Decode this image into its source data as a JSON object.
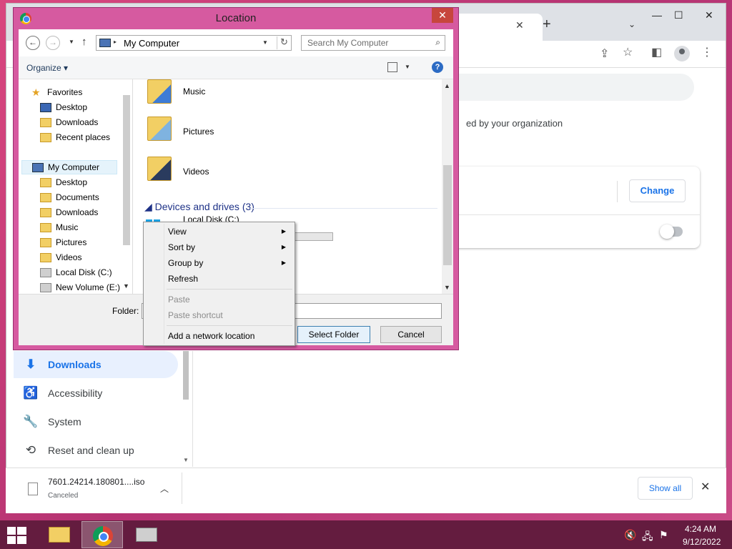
{
  "chrome": {
    "managed_text": "ed by your organization",
    "change_label": "Change",
    "nav_items": [
      {
        "label": "Downloads",
        "icon": "download-icon",
        "active": true
      },
      {
        "label": "Accessibility",
        "icon": "accessibility-icon",
        "active": false
      },
      {
        "label": "System",
        "icon": "wrench-icon",
        "active": false
      },
      {
        "label": "Reset and clean up",
        "icon": "restore-icon",
        "active": false
      }
    ],
    "download_bar": {
      "filename": "7601.24214.180801....iso",
      "status": "Canceled",
      "show_all": "Show all"
    }
  },
  "dialog": {
    "title": "Location",
    "address": "My Computer",
    "search_placeholder": "Search My Computer",
    "organize": "Organize",
    "nav_pane": [
      {
        "label": "Favorites",
        "icon": "star-icon"
      },
      {
        "label": "Desktop",
        "icon": "desktop-icon"
      },
      {
        "label": "Downloads",
        "icon": "downloads-folder-icon"
      },
      {
        "label": "Recent places",
        "icon": "recent-places-icon"
      },
      {
        "label": "My Computer",
        "icon": "computer-icon",
        "selected": true
      },
      {
        "label": "Desktop",
        "icon": "desktop-icon"
      },
      {
        "label": "Documents",
        "icon": "folder-icon"
      },
      {
        "label": "Downloads",
        "icon": "downloads-folder-icon"
      },
      {
        "label": "Music",
        "icon": "folder-icon"
      },
      {
        "label": "Pictures",
        "icon": "folder-icon"
      },
      {
        "label": "Videos",
        "icon": "folder-icon"
      },
      {
        "label": "Local Disk (C:)",
        "icon": "disk-icon"
      },
      {
        "label": "New Volume (E:)",
        "icon": "disk-icon"
      }
    ],
    "folders": [
      {
        "label": "Music",
        "icon": "music-folder-icon"
      },
      {
        "label": "Pictures",
        "icon": "pictures-folder-icon"
      },
      {
        "label": "Videos",
        "icon": "videos-folder-icon"
      }
    ],
    "devices_header": "Devices and drives (3)",
    "drive_label": "Local Disk (C:)",
    "folder_label": "Folder:",
    "select_folder": "Select Folder",
    "cancel": "Cancel"
  },
  "context_menu": {
    "view": "View",
    "sort_by": "Sort by",
    "group_by": "Group by",
    "refresh": "Refresh",
    "paste": "Paste",
    "paste_shortcut": "Paste shortcut",
    "add_network_location": "Add a network location"
  },
  "taskbar": {
    "time": "4:24 AM",
    "date": "9/12/2022"
  },
  "colors": {
    "accent": "#1a73e8",
    "dialog_frame": "#d65aa0",
    "taskbar": "#641c3f"
  }
}
